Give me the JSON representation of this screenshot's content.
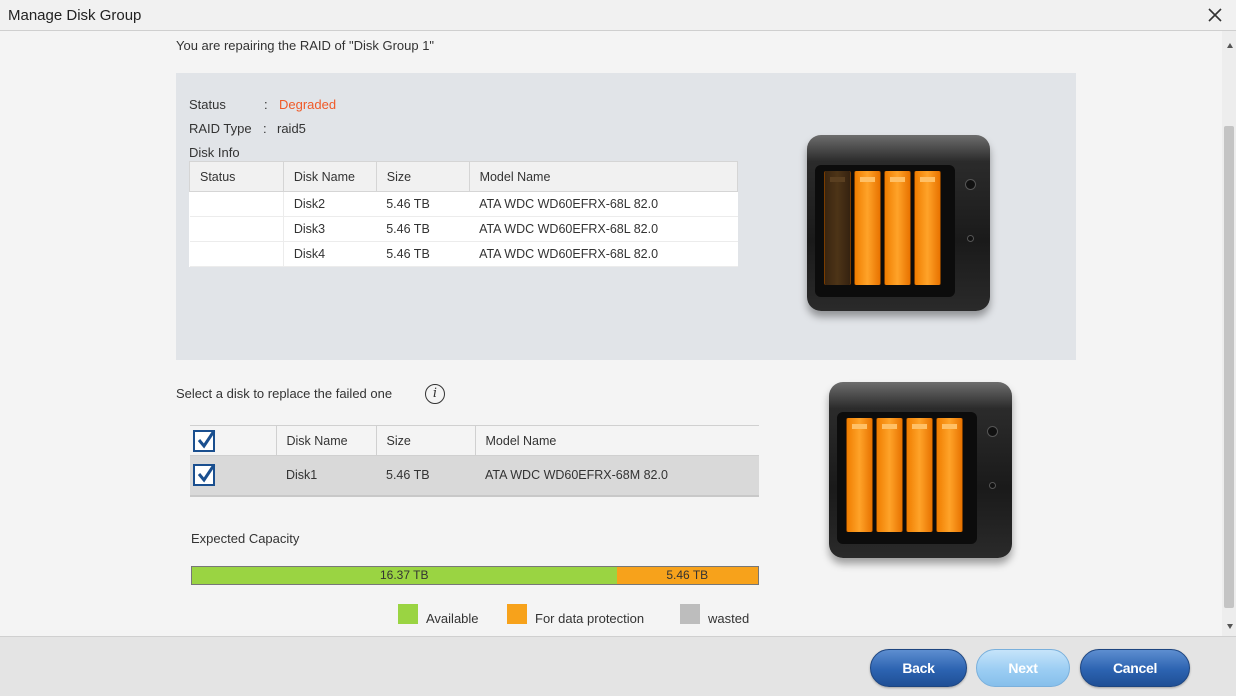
{
  "window": {
    "title": "Manage Disk Group"
  },
  "message": "You are repairing the RAID of \"Disk Group 1\"",
  "info": {
    "status_label": "Status",
    "status_sep": ":",
    "status_value": "Degraded",
    "raid_label": "RAID Type",
    "raid_sep": ":",
    "raid_value": "raid5",
    "disk_info_label": "Disk Info",
    "table": {
      "headers": [
        "Status",
        "Disk Name",
        "Size",
        "Model Name"
      ],
      "rows": [
        {
          "status": "",
          "name": "Disk2",
          "size": "5.46 TB",
          "model": "ATA WDC WD60EFRX-68L 82.0"
        },
        {
          "status": "",
          "name": "Disk3",
          "size": "5.46 TB",
          "model": "ATA WDC WD60EFRX-68L 82.0"
        },
        {
          "status": "",
          "name": "Disk4",
          "size": "5.46 TB",
          "model": "ATA WDC WD60EFRX-68L 82.0"
        }
      ]
    }
  },
  "select": {
    "label": "Select a disk to replace the failed one",
    "info_icon": "i",
    "headers": [
      "Disk Name",
      "Size",
      "Model Name"
    ],
    "rows": [
      {
        "checked": true,
        "name": "Disk1",
        "size": "5.46 TB",
        "model": "ATA WDC WD60EFRX-68M 82.0"
      }
    ]
  },
  "capacity": {
    "label": "Expected Capacity",
    "available_value": "16.37 TB",
    "protection_value": "5.46 TB",
    "available_fraction": 0.75,
    "protection_fraction": 0.25,
    "colors": {
      "available": "#9ad442",
      "protection": "#f7a21b",
      "wasted": "#bdbdbd"
    }
  },
  "legend": {
    "available": "Available",
    "protection": "For data protection",
    "wasted": "wasted"
  },
  "nas_current": {
    "bays_lit": [
      false,
      true,
      true,
      true
    ]
  },
  "nas_new": {
    "bays_lit": [
      true,
      true,
      true,
      true
    ]
  },
  "buttons": {
    "back": "Back",
    "next": "Next",
    "cancel": "Cancel"
  }
}
